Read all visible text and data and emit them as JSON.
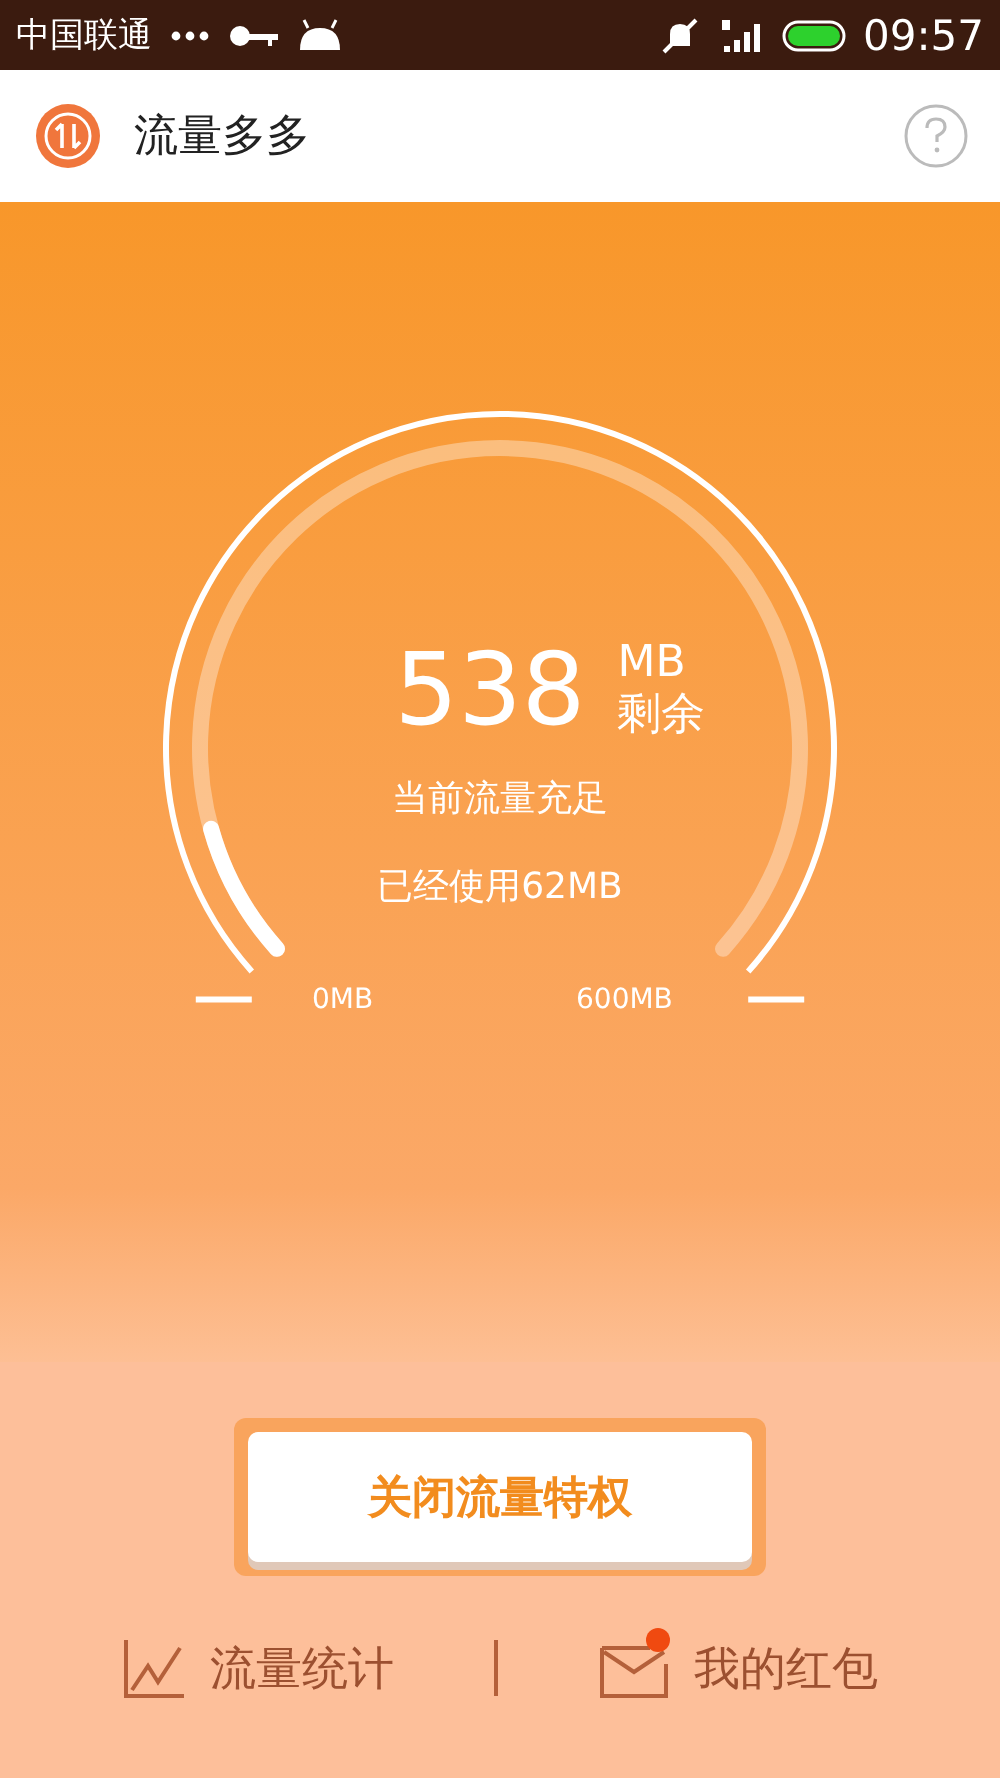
{
  "status_bar": {
    "carrier": "中国联通",
    "time": "09:57"
  },
  "app_bar": {
    "title": "流量多多"
  },
  "gauge": {
    "value": "538",
    "unit": "MB",
    "unit_label": "剩余",
    "status": "当前流量充足",
    "used": "已经使用62MB",
    "min_label": "0MB",
    "max_label": "600MB"
  },
  "primary_button": {
    "label": "关闭流量特权"
  },
  "bottom_nav": [
    {
      "kind": "stats",
      "label": "流量统计",
      "badge": false
    },
    {
      "kind": "redpacket",
      "label": "我的红包",
      "badge": true
    }
  ]
}
